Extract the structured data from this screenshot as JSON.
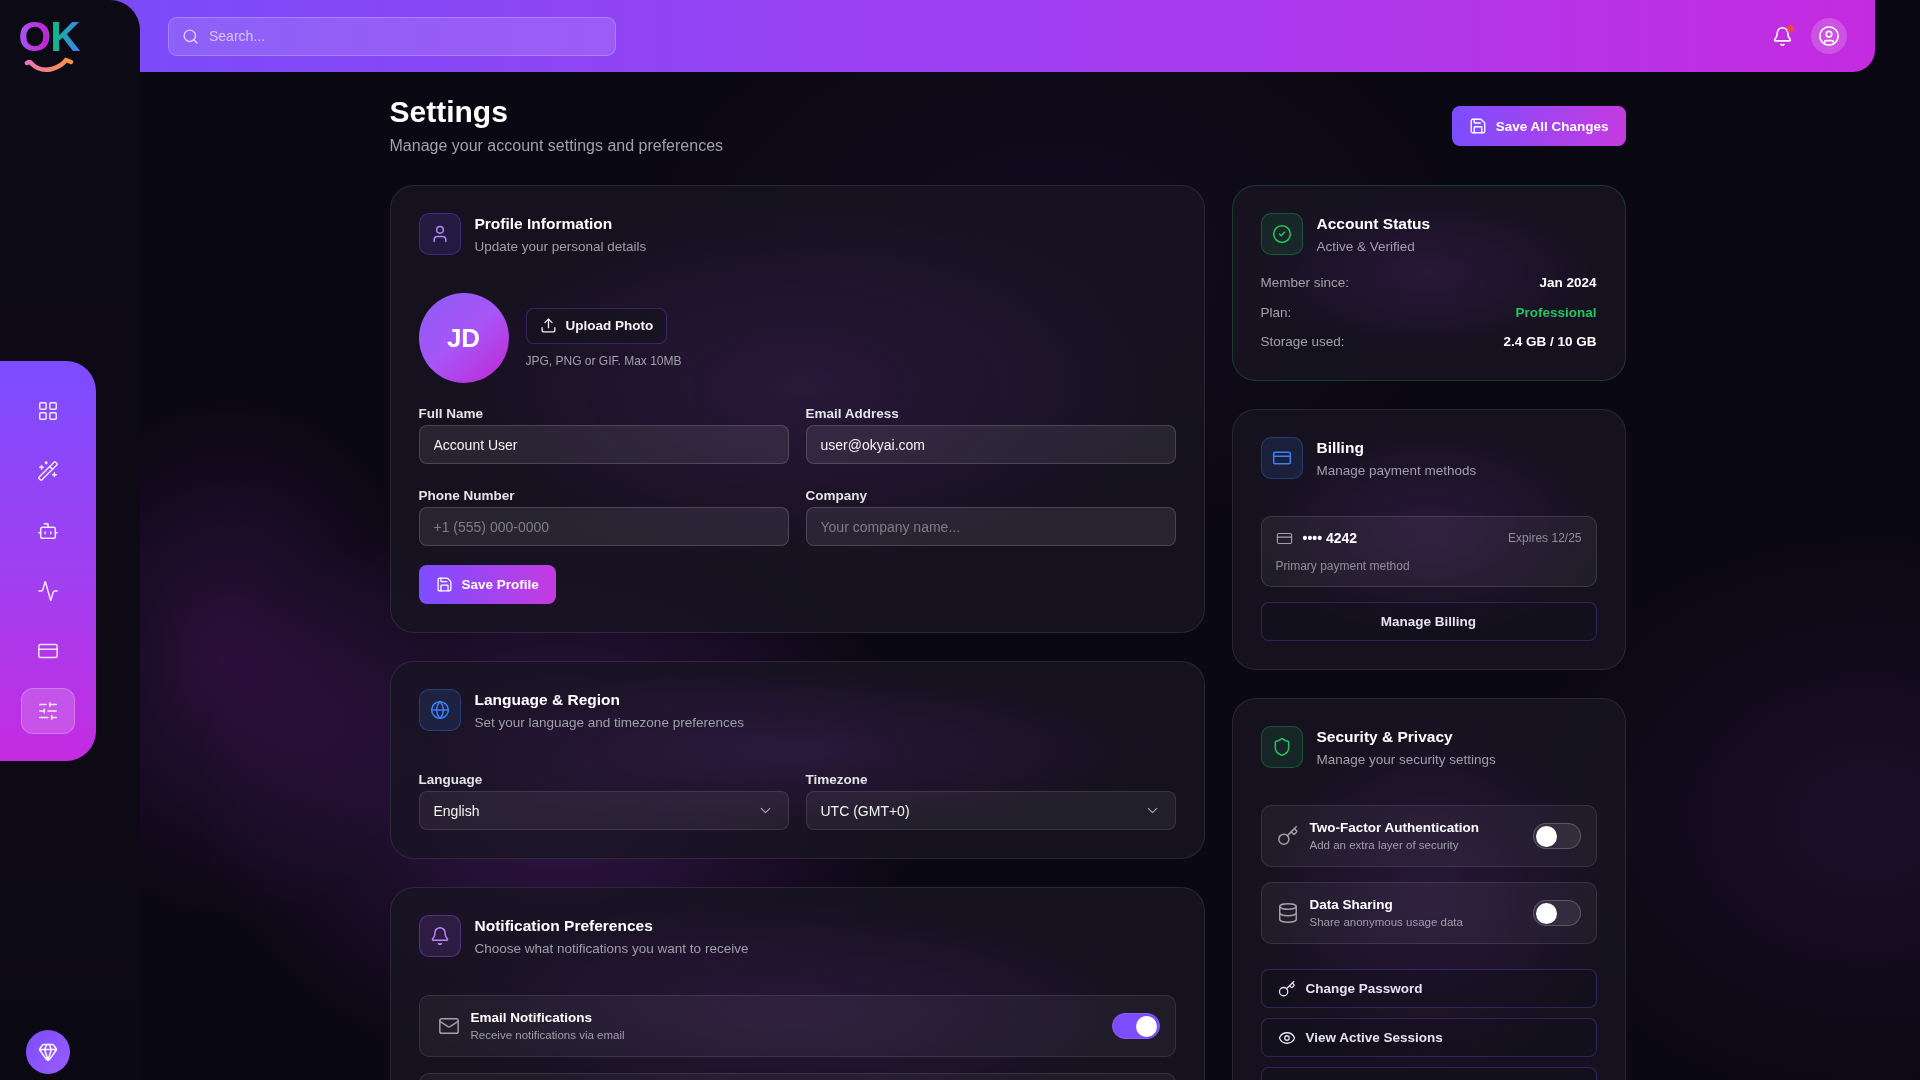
{
  "logo": {
    "text": "OK"
  },
  "sidebar": {
    "items": [
      {
        "selected": false
      },
      {
        "selected": false
      },
      {
        "selected": false
      },
      {
        "selected": false
      },
      {
        "selected": false
      },
      {
        "selected": true
      }
    ]
  },
  "header": {
    "search": {
      "placeholder": "Search..."
    },
    "notifications": {
      "unread": true
    }
  },
  "page": {
    "title": "Settings",
    "subtitle": "Manage your account settings and preferences",
    "save_all_button": "Save All Changes"
  },
  "profile": {
    "title": "Profile Information",
    "subtitle": "Update your personal details",
    "avatar_initials": "JD",
    "upload_button": "Upload Photo",
    "upload_hint": "JPG, PNG or GIF. Max 10MB",
    "fields": [
      {
        "label": "Full Name",
        "value": "Account User"
      },
      {
        "label": "Email Address",
        "value": "user@okyai.com"
      },
      {
        "label": "Phone Number",
        "placeholder": "+1 (555) 000-0000"
      },
      {
        "label": "Company",
        "placeholder": "Your company name..."
      }
    ],
    "save_button": "Save Profile"
  },
  "language_region": {
    "title": "Language & Region",
    "subtitle": "Set your language and timezone preferences",
    "selects": [
      {
        "label": "Language",
        "value": "English"
      },
      {
        "label": "Timezone",
        "value": "UTC (GMT+0)"
      }
    ]
  },
  "notifications": {
    "title": "Notification Preferences",
    "subtitle": "Choose what notifications you want to receive",
    "items": [
      {
        "label": "Email Notifications",
        "description": "Receive notifications via email",
        "on": true
      }
    ]
  },
  "account_status": {
    "title": "Account Status",
    "subtitle": "Active & Verified",
    "rows": [
      {
        "label": "Member since:",
        "value": "Jan 2024",
        "color": "#ffffff"
      },
      {
        "label": "Plan:",
        "value": "Professional",
        "color": "#22c55e"
      },
      {
        "label": "Storage used:",
        "value": "2.4 GB / 10 GB",
        "color": "#ffffff"
      }
    ]
  },
  "billing": {
    "title": "Billing",
    "subtitle": "Manage payment methods",
    "card": {
      "number": "•••• 4242",
      "expires": "Expires 12/25",
      "note": "Primary payment method"
    },
    "manage_button": "Manage Billing"
  },
  "security": {
    "title": "Security & Privacy",
    "subtitle": "Manage your security settings",
    "toggles": [
      {
        "label": "Two-Factor Authentication",
        "description": "Add an extra layer of security",
        "on": false
      },
      {
        "label": "Data Sharing",
        "description": "Share anonymous usage data",
        "on": false
      }
    ],
    "actions": [
      "Change Password",
      "View Active Sessions"
    ]
  }
}
